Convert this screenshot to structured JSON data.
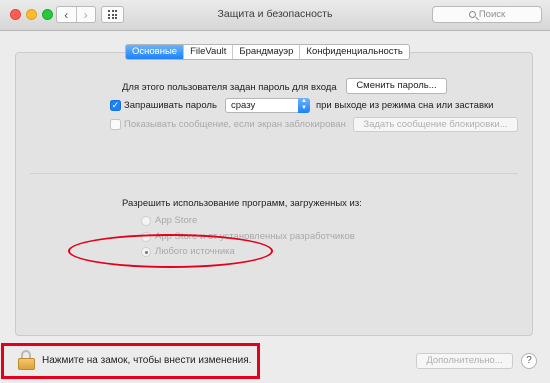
{
  "window": {
    "title": "Защита и безопасность",
    "search_placeholder": "Поиск"
  },
  "tabs": [
    {
      "label": "Основные",
      "active": true
    },
    {
      "label": "FileVault",
      "active": false
    },
    {
      "label": "Брандмауэр",
      "active": false
    },
    {
      "label": "Конфиденциальность",
      "active": false
    }
  ],
  "general": {
    "password_set_text": "Для этого пользователя задан пароль для входа",
    "change_password_button": "Сменить пароль...",
    "require_password": {
      "checked": true,
      "label": "Запрашивать пароль",
      "select_value": "сразу",
      "suffix": "при выходе из режима сна или заставки"
    },
    "show_message": {
      "checked": false,
      "label": "Показывать сообщение, если экран заблокирован",
      "button": "Задать сообщение блокировки..."
    }
  },
  "allow_apps": {
    "heading": "Разрешить использование программ, загруженных из:",
    "options": [
      {
        "label": "App Store",
        "selected": false
      },
      {
        "label": "App Store и от установленных разработчиков",
        "selected": false
      },
      {
        "label": "Любого источника",
        "selected": true
      }
    ]
  },
  "footer": {
    "lock_text": "Нажмите на замок, чтобы внести изменения.",
    "advanced_button": "Дополнительно...",
    "help_label": "?"
  },
  "colors": {
    "accent": "#1a82fb",
    "annotation_red": "#e4001b"
  }
}
